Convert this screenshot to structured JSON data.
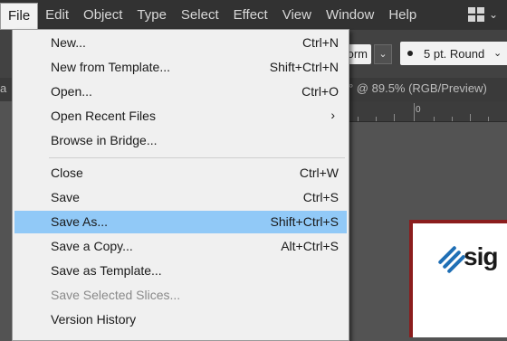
{
  "menubar": {
    "items": [
      "File",
      "Edit",
      "Object",
      "Type",
      "Select",
      "Effect",
      "View",
      "Window",
      "Help"
    ]
  },
  "controlbar": {
    "profile_value": "orm",
    "brush_value": "5 pt. Round"
  },
  "document": {
    "tab_left": "a",
    "tab_title": "° @ 89.5% (RGB/Preview)",
    "ruler_zero": "0",
    "logo_text": "sig"
  },
  "file_menu": {
    "items": [
      {
        "label": "New...",
        "shortcut": "Ctrl+N"
      },
      {
        "label": "New from Template...",
        "shortcut": "Shift+Ctrl+N"
      },
      {
        "label": "Open...",
        "shortcut": "Ctrl+O"
      },
      {
        "label": "Open Recent Files",
        "shortcut": ""
      },
      {
        "label": "Browse in Bridge...",
        "shortcut": ""
      },
      {
        "label": "Close",
        "shortcut": "Ctrl+W"
      },
      {
        "label": "Save",
        "shortcut": "Ctrl+S"
      },
      {
        "label": "Save As...",
        "shortcut": "Shift+Ctrl+S"
      },
      {
        "label": "Save a Copy...",
        "shortcut": "Alt+Ctrl+S"
      },
      {
        "label": "Save as Template...",
        "shortcut": ""
      },
      {
        "label": "Save Selected Slices...",
        "shortcut": ""
      },
      {
        "label": "Version History",
        "shortcut": ""
      }
    ],
    "highlighted": "Save As...",
    "disabled": [
      "Save Selected Slices..."
    ],
    "submenu": [
      "Open Recent Files"
    ]
  },
  "colors": {
    "menubar_bg": "#323232",
    "menu_bg": "#f0f0f0",
    "highlight": "#91c9f7",
    "artboard_border": "#8b1d1d",
    "logo_blue": "#1f6fb5"
  }
}
